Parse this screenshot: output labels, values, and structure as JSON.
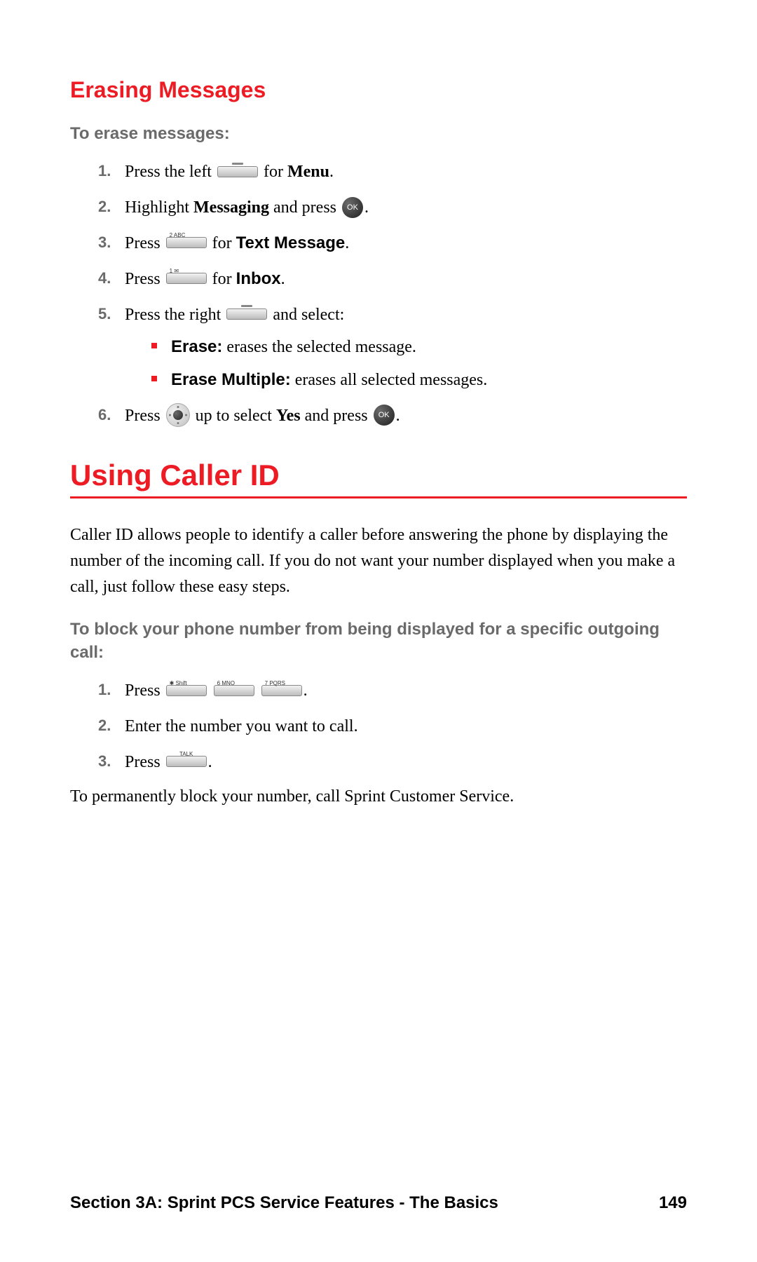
{
  "erasing": {
    "heading": "Erasing Messages",
    "sub": "To erase messages:",
    "step1_a": "Press the left ",
    "step1_b": " for ",
    "step1_menu": "Menu",
    "step1_c": ".",
    "step2_a": "Highlight ",
    "step2_messaging": "Messaging",
    "step2_b": " and press ",
    "step2_c": ".",
    "step3_a": "Press ",
    "step3_b": " for ",
    "step3_text": "Text Message",
    "step3_c": ".",
    "step4_a": "Press ",
    "step4_b": " for ",
    "step4_inbox": "Inbox",
    "step4_c": ".",
    "step5_a": "Press the right ",
    "step5_b": " and select:",
    "b1_bold": "Erase:",
    "b1_rest": " erases the selected message.",
    "b2_bold": "Erase Multiple:",
    "b2_rest": " erases all selected messages.",
    "step6_a": "Press ",
    "step6_b": " up to select ",
    "step6_yes": "Yes",
    "step6_c": " and press ",
    "step6_d": "."
  },
  "keys": {
    "ok": "OK",
    "two": "2 ABC",
    "one": "1 ✉",
    "star": "✱ Shift",
    "six": "6 MNO",
    "seven": "7 PQRS",
    "talk": "TALK"
  },
  "callerid": {
    "heading": "Using Caller ID",
    "para": "Caller ID allows people to identify a caller before answering the phone by displaying the number of the incoming call. If you do not want your number displayed when you make a call, just follow these easy steps.",
    "sub": "To block your phone number from being displayed for a specific outgoing call:",
    "step1_a": "Press ",
    "step1_b": ".",
    "step2": "Enter the number you want to call.",
    "step3_a": "Press ",
    "step3_b": ".",
    "perm": "To permanently block your number, call Sprint Customer Service."
  },
  "footer": {
    "section": "Section 3A: Sprint PCS Service Features - The Basics",
    "page": "149"
  }
}
